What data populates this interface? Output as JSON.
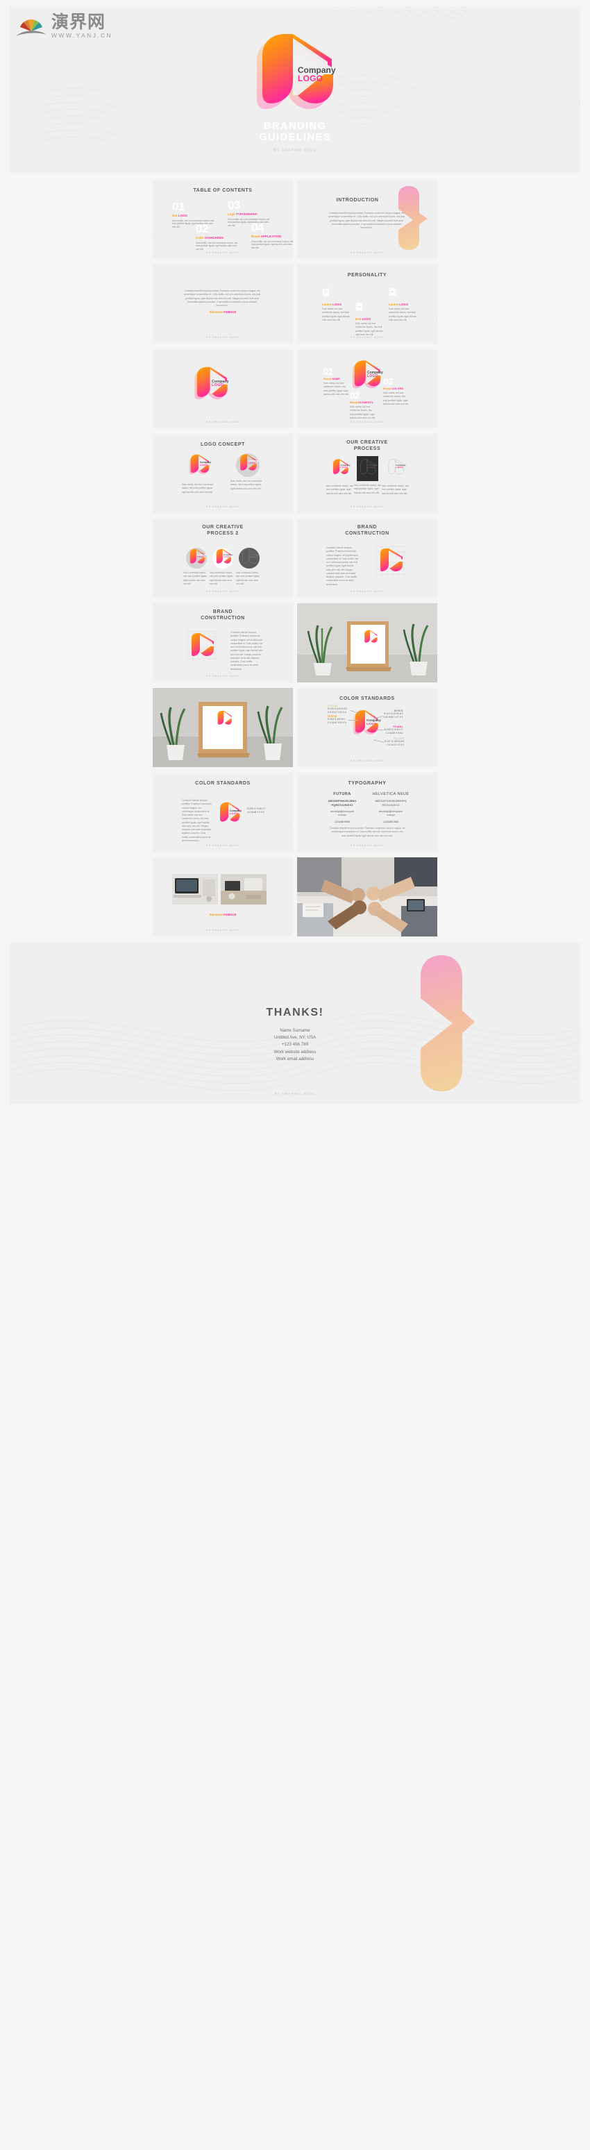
{
  "watermark": {
    "name": "演界网",
    "url": "WWW.YANJ.CN"
  },
  "brand": {
    "company_line1": "Company",
    "company_line2": "LOGO",
    "byline": "BY GRAPHIC NODE",
    "colors": {
      "orange": "#F9A11B",
      "orange_deep": "#FB8C1C",
      "pink": "#FF2D96",
      "peach": "#F6D5A8",
      "pink_light": "#F7B7D6",
      "gray_dark": "#4D4D4D",
      "slide_bg": "#EFEFEF",
      "page_bg": "#F5F5F5"
    }
  },
  "hero": {
    "title_line1": "BRANDING",
    "title_line2": "GUIDELINES",
    "byline": "BY GRAPHIC NODE"
  },
  "lorem": {
    "short": "Duis mollis, est non commodo luctus, nisi erat porttitor ligula, eget lacinia odio sem nec elit.",
    "short2": "Duis mollis, est non commodo luctus, nisi erat porttitor ligula, eget lacinia odio sem nec elit.",
    "process": "Non commodo luctus, nisi erat porttitor ligula, eget lacinia odio sem nec elit.",
    "long": "Curabitur blandit tempus porttitor. Praesent commodo cursus magna, vel scelerisque consectetur et. Duis mollis, est non commodo luctus, nisi erat porttitor ligula, eget lacinia odio sem nec elit. Integer posuere erat ante venenatis dapibus posuere. Cras mattis consectetur purus sit amet fermentum.",
    "typo": "Curabitur blandit tempus porttitor. Praesent commodo cursus magna, vel scelerisque consectetur et. Duis mollis, est non commodo luctus, nisi erat porttitor ligula, eget lacinia odio sem nec elit."
  },
  "slides": {
    "toc": {
      "title": "TABLE OF CONTENTS",
      "items": [
        {
          "num": "01",
          "label_a": "Our ",
          "label_b": "LOGO"
        },
        {
          "num": "02",
          "label_a": "Color ",
          "label_b": "STANDARDS"
        },
        {
          "num": "03",
          "label_a": "Logo ",
          "label_b": "TYPOGRAPHY"
        },
        {
          "num": "04",
          "label_a": "Brand ",
          "label_b": "APPLICATION"
        }
      ]
    },
    "introduction": {
      "title": "INTRODUCTION"
    },
    "quote": {
      "attribution_a": "Someone ",
      "attribution_b": "FAMOUS"
    },
    "personality": {
      "title": "PERSONALITY",
      "items": [
        {
          "icon": "clipboard-icon",
          "label_a": "Luctus ",
          "label_b": "LOGO"
        },
        {
          "icon": "video-icon",
          "label_a": "Erat ",
          "label_b": "LOGO"
        },
        {
          "icon": "film-icon",
          "label_a": "Luctus ",
          "label_b": "LOGO"
        }
      ]
    },
    "logo_plain": {
      "title": ""
    },
    "brand_parts": {
      "items": [
        {
          "num": "01",
          "label_a": "Brand ",
          "label_b": "NAME"
        },
        {
          "num": "02",
          "label_a": "Brand ",
          "label_b": "ELEMENTS"
        },
        {
          "num": "03",
          "label_a": "Brand ",
          "label_b": "COLORS"
        }
      ]
    },
    "logo_concept": {
      "title": "LOGO CONCEPT"
    },
    "creative_process": {
      "title_line1": "OUR CREATIVE",
      "title_line2": "PROCESS"
    },
    "creative_process_2": {
      "title_line1": "OUR CREATIVE",
      "title_line2": "PROCESS 2"
    },
    "brand_construction": {
      "title_line1": "BRAND",
      "title_line2": "CONSTRUCTION"
    },
    "color_standards": {
      "title": "COLOR STANDARDS",
      "swatches": [
        {
          "hex": "EFD4A8",
          "hex_color": "#E8C89A",
          "rgb": "R:239   G:216   B:167",
          "cmyk": "C:6   M:12   Y:22   K:0"
        },
        {
          "hex": "FE8F36",
          "hex_color": "#F9A11B",
          "rgb": "R:254   G:159   B:0",
          "cmyk": "C:0   M:40   Y:99   K:0"
        },
        {
          "hex": "6E7070",
          "hex_color": "#7E8080",
          "rgb": "R:110   G:112   B:112",
          "cmyk": "C:60   M:50   Y:47   K:0"
        },
        {
          "hex": "FF4AB1",
          "hex_color": "#FF2D96",
          "rgb": "R:255   G:74   B:177",
          "cmyk": "C:0   M:68   Y:0   K:0"
        },
        {
          "hex": "EDC3DB",
          "hex_color": "#F0B9D8",
          "rgb": "R:237   G:195   B:219",
          "cmyk": "C:6   M:24   Y:2   K:0"
        }
      ]
    },
    "typography": {
      "title": "TYPOGRAPHY",
      "fonts": [
        {
          "name": "FUTURA",
          "upper1": "ABCDEFGHIJKLMNO",
          "upper2": "PQRSTUVWXYZ",
          "lower1": "abcdefghijklmnopqrst",
          "lower2": "uvwxyz",
          "digits": "1234567890"
        },
        {
          "name": "HELVETICA NEUE",
          "upper1": "ABCDEFGHIJKLMNOPQ",
          "upper2": "RSTUVWXYZ",
          "lower1": "abcdefghijklmnopqrst",
          "lower2": "uvwxyz",
          "digits": "1234567890"
        }
      ]
    },
    "mockup_photos": {
      "caption_a": "Someone ",
      "caption_b": "FAMOUS"
    }
  },
  "thanks": {
    "title": "THANKS!",
    "contact_lines": [
      "Name Surname",
      "Untitled Ave, NY, USA",
      "+123 456 789",
      "Work website address",
      "Work email address"
    ],
    "byline": "BY GRAPHIC NODE"
  }
}
